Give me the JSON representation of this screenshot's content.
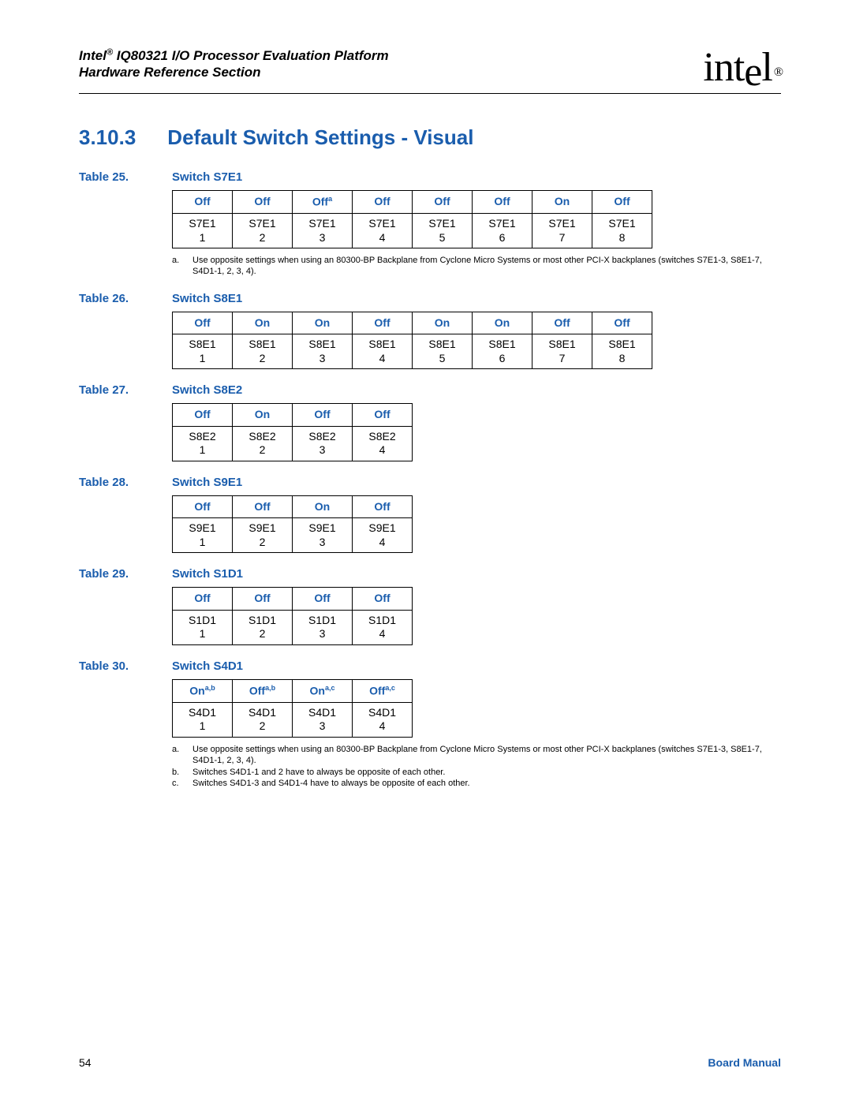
{
  "header": {
    "line1_prefix": "Intel",
    "line1_suffix": " IQ80321 I/O Processor Evaluation Platform",
    "line2": "Hardware Reference Section",
    "logo_text": "int",
    "logo_text2": "e",
    "logo_text3": "l"
  },
  "section": {
    "number": "3.10.3",
    "title": "Default Switch Settings - Visual"
  },
  "tables": {
    "t25": {
      "cap_num": "Table 25.",
      "cap_title": "Switch S7E1",
      "states": [
        "Off",
        "Off",
        "Off",
        "Off",
        "Off",
        "Off",
        "On",
        "Off"
      ],
      "state_sup": {
        "2": "a"
      },
      "labels": [
        "S7E1",
        "S7E1",
        "S7E1",
        "S7E1",
        "S7E1",
        "S7E1",
        "S7E1",
        "S7E1"
      ],
      "nums": [
        "1",
        "2",
        "3",
        "4",
        "5",
        "6",
        "7",
        "8"
      ],
      "notes": [
        {
          "l": "a.",
          "t": "Use opposite settings when using an 80300-BP Backplane from Cyclone Micro Systems or most other PCI-X backplanes (switches S7E1-3, S8E1-7, S4D1-1, 2, 3, 4)."
        }
      ]
    },
    "t26": {
      "cap_num": "Table 26.",
      "cap_title": "Switch S8E1",
      "states": [
        "Off",
        "On",
        "On",
        "Off",
        "On",
        "On",
        "Off",
        "Off"
      ],
      "labels": [
        "S8E1",
        "S8E1",
        "S8E1",
        "S8E1",
        "S8E1",
        "S8E1",
        "S8E1",
        "S8E1"
      ],
      "nums": [
        "1",
        "2",
        "3",
        "4",
        "5",
        "6",
        "7",
        "8"
      ]
    },
    "t27": {
      "cap_num": "Table 27.",
      "cap_title": "Switch S8E2",
      "states": [
        "Off",
        "On",
        "Off",
        "Off"
      ],
      "labels": [
        "S8E2",
        "S8E2",
        "S8E2",
        "S8E2"
      ],
      "nums": [
        "1",
        "2",
        "3",
        "4"
      ]
    },
    "t28": {
      "cap_num": "Table 28.",
      "cap_title": "Switch S9E1",
      "states": [
        "Off",
        "Off",
        "On",
        "Off"
      ],
      "labels": [
        "S9E1",
        "S9E1",
        "S9E1",
        "S9E1"
      ],
      "nums": [
        "1",
        "2",
        "3",
        "4"
      ]
    },
    "t29": {
      "cap_num": "Table 29.",
      "cap_title": "Switch S1D1",
      "states": [
        "Off",
        "Off",
        "Off",
        "Off"
      ],
      "labels": [
        "S1D1",
        "S1D1",
        "S1D1",
        "S1D1"
      ],
      "nums": [
        "1",
        "2",
        "3",
        "4"
      ]
    },
    "t30": {
      "cap_num": "Table 30.",
      "cap_title": "Switch S4D1",
      "states": [
        "On",
        "Off",
        "On",
        "Off"
      ],
      "state_sup": {
        "0": "a,b",
        "1": "a,b",
        "2": "a,c",
        "3": "a,c"
      },
      "labels": [
        "S4D1",
        "S4D1",
        "S4D1",
        "S4D1"
      ],
      "nums": [
        "1",
        "2",
        "3",
        "4"
      ],
      "notes": [
        {
          "l": "a.",
          "t": "Use opposite settings when using an 80300-BP Backplane from Cyclone Micro Systems or most other PCI-X backplanes (switches S7E1-3, S8E1-7, S4D1-1, 2, 3, 4)."
        },
        {
          "l": "b.",
          "t": "Switches S4D1-1 and 2 have to always be opposite of each other."
        },
        {
          "l": "c.",
          "t": "Switches S4D1-3 and S4D1-4 have to always be opposite of each other."
        }
      ]
    }
  },
  "footer": {
    "page": "54",
    "label": "Board Manual"
  }
}
